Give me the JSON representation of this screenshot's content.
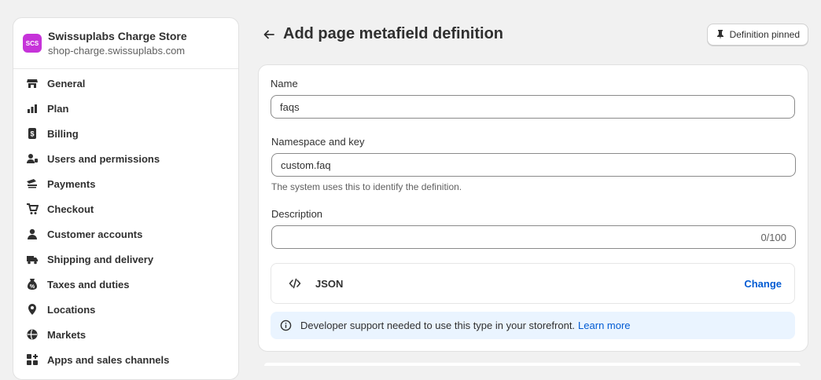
{
  "sidebar": {
    "store": {
      "initials": "SCS",
      "name": "Swissuplabs Charge Store",
      "domain": "shop-charge.swissuplabs.com"
    },
    "items": [
      {
        "label": "General",
        "icon": "store-icon"
      },
      {
        "label": "Plan",
        "icon": "plan-icon"
      },
      {
        "label": "Billing",
        "icon": "billing-icon"
      },
      {
        "label": "Users and permissions",
        "icon": "users-icon"
      },
      {
        "label": "Payments",
        "icon": "payments-icon"
      },
      {
        "label": "Checkout",
        "icon": "cart-icon"
      },
      {
        "label": "Customer accounts",
        "icon": "person-icon"
      },
      {
        "label": "Shipping and delivery",
        "icon": "truck-icon"
      },
      {
        "label": "Taxes and duties",
        "icon": "tax-icon"
      },
      {
        "label": "Locations",
        "icon": "location-icon"
      },
      {
        "label": "Markets",
        "icon": "globe-icon"
      },
      {
        "label": "Apps and sales channels",
        "icon": "apps-icon"
      }
    ]
  },
  "header": {
    "title": "Add page metafield definition",
    "pin_label": "Definition pinned"
  },
  "form": {
    "name": {
      "label": "Name",
      "value": "faqs"
    },
    "namespace": {
      "label": "Namespace and key",
      "value": "custom.faq",
      "help": "The system uses this to identify the definition."
    },
    "description": {
      "label": "Description",
      "value": "",
      "count": "0/100"
    },
    "type": {
      "name": "JSON",
      "change_label": "Change"
    },
    "banner": {
      "text": "Developer support needed to use this type in your storefront.",
      "link": "Learn more"
    }
  }
}
